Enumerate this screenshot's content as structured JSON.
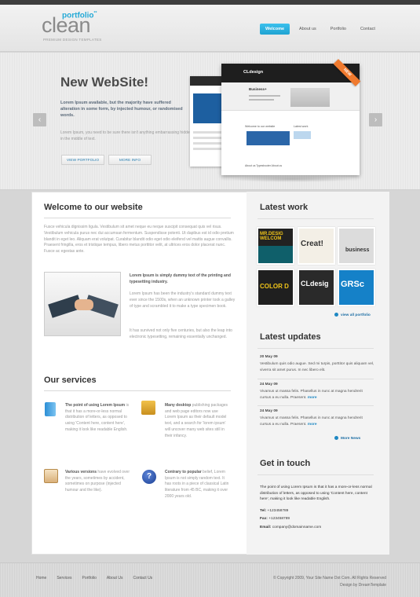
{
  "logo": {
    "portfolio": "portfolio",
    "stars": "**",
    "main": "clean",
    "tagline": "PREMIUM DESIGN TEMPLATES"
  },
  "nav": [
    {
      "label": "Welcome",
      "active": true
    },
    {
      "label": "About us"
    },
    {
      "label": "Portfolio"
    },
    {
      "label": "Contact"
    }
  ],
  "hero": {
    "title": "New WebSite!",
    "lead": "Lorem Ipsum available, but the majority have suffered alteration in some form, by injected humour, or randomised words.",
    "text": "Lorem Ipsum, you need to be sure there isn't anything embarrassing hidden in the middle of text.",
    "btn_portfolio": "VIEW PORTFOLIO",
    "btn_more": "MORE INFO",
    "ribbon": "NEW",
    "shot_title": "CLdesign",
    "shot_heading": "Business+",
    "shot_sub1": "Welcome to our website",
    "shot_sub2": "Latest work",
    "shot_foot": "About us     Typeshooter     About us",
    "prev": "‹",
    "next": "›"
  },
  "welcome": {
    "title": "Welcome to our website",
    "para": "Fusce vehicula dignissim ligula. Vestibulum sit amet neque eu neque suscipit consequat quis vel risus. Vestibulum vehicula purus nec dui accumsan fermentum. Suspendisse potenti. Ut dapibus est id odio pretium blandit in eget leo. Aliquam erat volutpat. Curabitur blandit odio eget odio eleifend vel mattis augue convallis. Praesent fringilla, eros et tristique tempus, libero metus porttitor velit, at ultrices eros dolor placerat nunc. Fusce ac egestas ante.",
    "side_lead": "Lorem Ipsum is simply dummy text of the printing and typesetting industry.",
    "side_p1": "Lorem Ipsum has been the industry's standard dummy text ever since the 1500s, when an unknown printer took a galley of type and scrambled it to make a type specimen book.",
    "side_p2": "It has survived not only five centuries, but also the leap into electronic typesetting, remaining essentially unchanged."
  },
  "services": {
    "title": "Our services",
    "items": [
      {
        "icon": "book-icon",
        "bold": "The point of using Lorem Ipsum",
        "text": " is that it has a more-or-less normal distribution of letters, as opposed to using 'Content here, content here', making it look like readable English."
      },
      {
        "icon": "toolbox-icon",
        "bold": "Many desktop",
        "text": " publishing packages and web page editors now use Lorem Ipsum as their default model text, and a search for 'lorem ipsum' will uncover many web sites still in their infancy."
      },
      {
        "icon": "clipboard-icon",
        "bold": "Various versions",
        "text": " have evolved over the years, sometimes by accident, sometimes on purpose (injected humour and the like)."
      },
      {
        "icon": "help-icon",
        "bold": "Contrary to popular",
        "text": " belief, Lorem Ipsum is not simply random text. It has roots in a piece of classical Latin literature from 45 BC, making it over 2000 years old."
      }
    ]
  },
  "latest_work": {
    "title": "Latest work",
    "thumbs": [
      "MR.DESIG WELCOM",
      "Creat!",
      "business",
      "COLOR D",
      "CLdesig",
      "GRSc"
    ],
    "link": "view all portfolio"
  },
  "updates": {
    "title": "Latest updates",
    "items": [
      {
        "date": "20 May 09",
        "text": "Vestibulum quis odio augue. Sed mi turpis, porttitor quis aliquam vel, viverra sit amet purus. In nec libero elit."
      },
      {
        "date": "24 May 09",
        "text": "Vivamus ut massa felis. Phasellus in nunc at magna hendrerit cursus a eu nulla. Praesent."
      },
      {
        "date": "24 May 09",
        "text": "Vivamus ut massa felis. Phasellus in nunc at magna hendrerit cursus a eu nulla. Praesent."
      }
    ],
    "more": "more",
    "link": "More News"
  },
  "contact": {
    "title": "Get in touch",
    "text": "The point of using Lorem Ipsum is that it has a more-or-less normal distribution of letters, as opposed to using 'Content here, content here', making it look like readable English.",
    "tel_label": "Tel:",
    "tel": "+123458789",
    "fax_label": "Fax:",
    "fax": "+123458789",
    "email_label": "Email:",
    "email": "company@domainname.com"
  },
  "footer": {
    "links": [
      "Home",
      "Services",
      "Portfolio",
      "About Us",
      "Contact Us"
    ],
    "copyright": "© Copyright 2009, Your Site Name Dot Com. All Rights Reserved",
    "credit": "Design by DreamTemplate"
  }
}
